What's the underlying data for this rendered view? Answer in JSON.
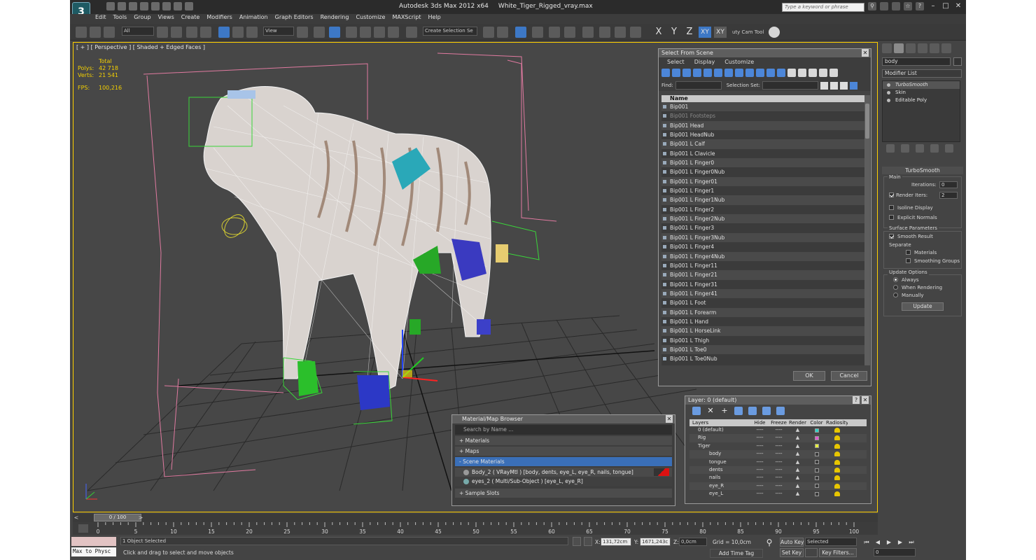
{
  "window": {
    "app_title": "Autodesk 3ds Max  2012 x64",
    "file_name": "White_Tiger_Rigged_vray.max",
    "search_placeholder": "Type a keyword or phrase",
    "logo_text": "3"
  },
  "menu": [
    "Edit",
    "Tools",
    "Group",
    "Views",
    "Create",
    "Modifiers",
    "Animation",
    "Graph Editors",
    "Rendering",
    "Customize",
    "MAXScript",
    "Help"
  ],
  "toolbar": {
    "selection_filter": "All",
    "ref_coord": "View",
    "named_selection": "Create Selection Se",
    "axis_x": "X",
    "axis_y": "Y",
    "axis_z": "Z",
    "axis_xy": "XY",
    "axis_xy2": "XY",
    "cam_tool": "uty Cam Tool"
  },
  "viewport": {
    "label": "[ + ] [ Perspective ] [ Shaded + Edged Faces ]",
    "stats_total": "Total",
    "polys_label": "Polys:",
    "polys_value": "42 718",
    "verts_label": "Verts:",
    "verts_value": "21 541",
    "fps_label": "FPS:",
    "fps_value": "100,216"
  },
  "select_from_scene": {
    "title": "Select From Scene",
    "menu": [
      "Select",
      "Display",
      "Customize"
    ],
    "find_label": "Find:",
    "selection_set_label": "Selection Set:",
    "column_name": "Name",
    "items": [
      {
        "name": "Bip001",
        "dim": false
      },
      {
        "name": "Bip001 Footsteps",
        "dim": true
      },
      {
        "name": "Bip001 Head",
        "dim": false
      },
      {
        "name": "Bip001 HeadNub",
        "dim": false
      },
      {
        "name": "Bip001 L Calf",
        "dim": false
      },
      {
        "name": "Bip001 L Clavicle",
        "dim": false
      },
      {
        "name": "Bip001 L Finger0",
        "dim": false
      },
      {
        "name": "Bip001 L Finger0Nub",
        "dim": false
      },
      {
        "name": "Bip001 L Finger01",
        "dim": false
      },
      {
        "name": "Bip001 L Finger1",
        "dim": false
      },
      {
        "name": "Bip001 L Finger1Nub",
        "dim": false
      },
      {
        "name": "Bip001 L Finger2",
        "dim": false
      },
      {
        "name": "Bip001 L Finger2Nub",
        "dim": false
      },
      {
        "name": "Bip001 L Finger3",
        "dim": false
      },
      {
        "name": "Bip001 L Finger3Nub",
        "dim": false
      },
      {
        "name": "Bip001 L Finger4",
        "dim": false
      },
      {
        "name": "Bip001 L Finger4Nub",
        "dim": false
      },
      {
        "name": "Bip001 L Finger11",
        "dim": false
      },
      {
        "name": "Bip001 L Finger21",
        "dim": false
      },
      {
        "name": "Bip001 L Finger31",
        "dim": false
      },
      {
        "name": "Bip001 L Finger41",
        "dim": false
      },
      {
        "name": "Bip001 L Foot",
        "dim": false
      },
      {
        "name": "Bip001 L Forearm",
        "dim": false
      },
      {
        "name": "Bip001 L Hand",
        "dim": false
      },
      {
        "name": "Bip001 L HorseLink",
        "dim": false
      },
      {
        "name": "Bip001 L Thigh",
        "dim": false
      },
      {
        "name": "Bip001 L Toe0",
        "dim": false
      },
      {
        "name": "Bip001 L Toe0Nub",
        "dim": false
      }
    ],
    "ok_label": "OK",
    "cancel_label": "Cancel"
  },
  "layer_dialog": {
    "title": "Layer: 0 (default)",
    "help": "?",
    "columns": {
      "layers": "Layers",
      "hide": "Hide",
      "freeze": "Freeze",
      "render": "Render",
      "color": "Color",
      "radiosity": "Radiosity"
    },
    "rows": [
      {
        "name": "0 (default)",
        "indent": 1,
        "color": "#2fd1c6"
      },
      {
        "name": "Rig",
        "indent": 1,
        "color": "#e05ad0"
      },
      {
        "name": "Tiger",
        "indent": 1,
        "color": "#e6f03a"
      },
      {
        "name": "body",
        "indent": 2,
        "color": "#3a3a3a"
      },
      {
        "name": "tongue",
        "indent": 2,
        "color": "#3a3a3a"
      },
      {
        "name": "dents",
        "indent": 2,
        "color": "#3a3a3a"
      },
      {
        "name": "nails",
        "indent": 2,
        "color": "#3a3a3a"
      },
      {
        "name": "eye_R",
        "indent": 2,
        "color": "#3a3a3a"
      },
      {
        "name": "eye_L",
        "indent": 2,
        "color": "#3a3a3a"
      }
    ],
    "dash": "----"
  },
  "material_browser": {
    "title": "Material/Map Browser",
    "search_placeholder": "Search by Name ...",
    "sections": [
      "+ Materials",
      "+ Maps",
      "- Scene Materials"
    ],
    "scene_materials": [
      "Body_2  ( VRayMtl ) [body, dents, eye_L, eye_R, nails, tongue]",
      "eyes_2  ( Multi/Sub-Object ) [eye_L, eye_R]"
    ],
    "sample_slots": "+ Sample Slots"
  },
  "command_panel": {
    "object_name": "body",
    "modifier_list": "Modifier List",
    "stack": [
      "TurboSmooth",
      "Skin",
      "Editable Poly"
    ],
    "rollout": "TurboSmooth",
    "main_group": "Main",
    "iterations_label": "Iterations:",
    "iterations_value": "0",
    "render_iters_label": "Render Iters:",
    "render_iters_value": "2",
    "isoline": "Isoline Display",
    "explicit_normals": "Explicit Normals",
    "surface_params": "Surface Parameters",
    "smooth_result": "Smooth Result",
    "separate": "Separate",
    "materials": "Materials",
    "smoothing_groups": "Smoothing Groups",
    "update_options": "Update Options",
    "always": "Always",
    "when_rendering": "When Rendering",
    "manually": "Manually",
    "update_btn": "Update"
  },
  "timeline": {
    "frame_display": "0 / 100",
    "ticks": [
      "0",
      "5",
      "10",
      "15",
      "20",
      "25",
      "30",
      "35",
      "40",
      "45",
      "50",
      "55",
      "60",
      "65",
      "70",
      "75",
      "80",
      "85",
      "90",
      "95",
      "100"
    ]
  },
  "status": {
    "listener": "Max to Physc",
    "selected_count": "1 Object Selected",
    "prompt": "Click and drag to select and move objects",
    "x_label": "X:",
    "x_value": "131,72cm",
    "y_label": "Y:",
    "y_value": "1671,243c",
    "z_label": "Z:",
    "z_value": "0,0cm",
    "grid": "Grid = 10,0cm",
    "add_time_tag": "Add Time Tag",
    "auto_key": "Auto Key",
    "set_key": "Set Key",
    "key_mode": "Selected",
    "key_filters": "Key Filters...",
    "frame_value": "0"
  }
}
